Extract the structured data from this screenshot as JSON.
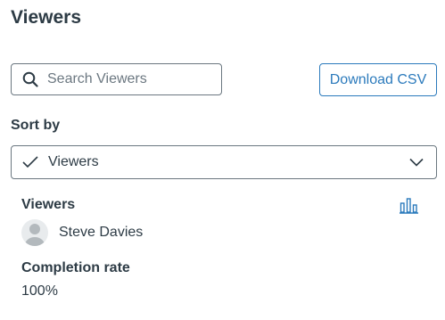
{
  "header": {
    "title": "Viewers"
  },
  "search": {
    "placeholder": "Search Viewers",
    "value": ""
  },
  "toolbar": {
    "download_label": "Download CSV"
  },
  "sort": {
    "label": "Sort by",
    "selected": "Viewers"
  },
  "viewers": {
    "heading": "Viewers",
    "chart_icon": "bar-chart-icon",
    "items": [
      {
        "name": "Steve Davies",
        "avatar": "default-avatar"
      }
    ]
  },
  "completion": {
    "heading": "Completion rate",
    "value": "100%"
  },
  "colors": {
    "text": "#2d3b45",
    "accent": "#2b7abc",
    "border": "#6b7780"
  }
}
